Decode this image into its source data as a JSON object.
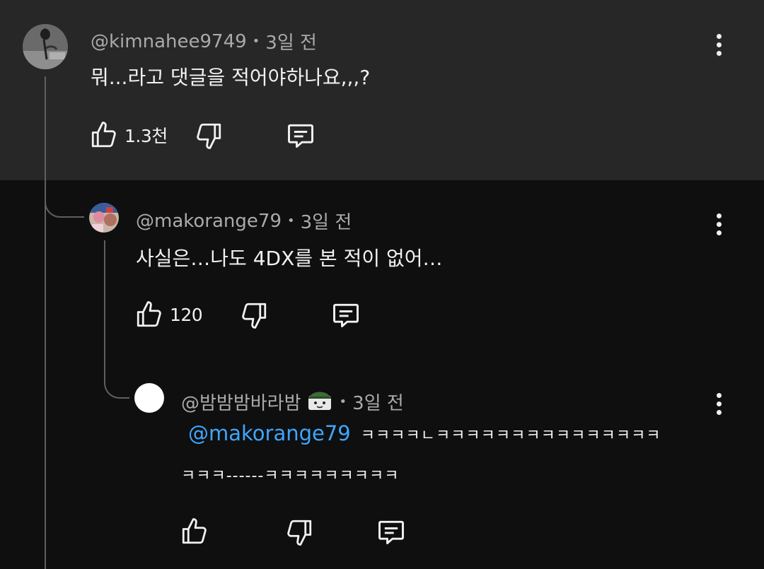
{
  "comments": [
    {
      "author": "@kimnahee9749",
      "time": "3일 전",
      "text": "뭐...라고 댓글을 적어야하나요,,,?",
      "likes": "1.3천",
      "avatar_icon": "rose-photo-avatar"
    },
    {
      "author": "@makorange79",
      "time": "3일 전",
      "text": "사실은…나도 4DX를 본 적이 없어…",
      "likes": "120",
      "avatar_icon": "photo-avatar"
    },
    {
      "author": "@밤밤밤바라밤",
      "time": "3일 전",
      "mention": "@makorange79",
      "text_line1": "ㅋㅋㅋㅋㄴㅋㅋㅋㅋㅋㅋㅋㅋㅋㅋㅋㅋㅋㅋㅋ",
      "text_line2": "ㅋㅋㅋ------ㅋㅋㅋㅋㅋㅋㅋㅋㅋ",
      "likes": "",
      "avatar_icon": "white-circle-avatar",
      "badge_icon": "member-badge-icon"
    }
  ],
  "separator": "•",
  "icons": [
    "thumbs-up-icon",
    "thumbs-down-icon",
    "reply-icon",
    "more-options-icon"
  ],
  "colors": {
    "highlight_bg": "#272727",
    "bg": "#0f0f0f",
    "mention": "#3ea6ff",
    "meta": "#aaaaaa",
    "thread_line": "#5f5f5f"
  }
}
